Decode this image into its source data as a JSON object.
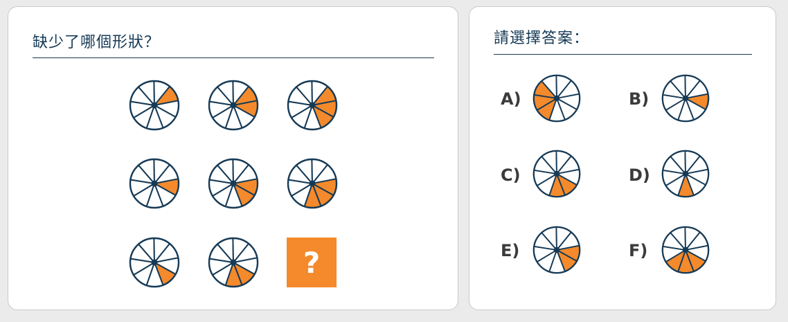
{
  "puzzle": {
    "title": "缺少了哪個形狀？",
    "missing_symbol": "?",
    "grid": [
      [
        {
          "shaded": [
            0
          ]
        },
        {
          "shaded": [
            0,
            1
          ]
        },
        {
          "shaded": [
            0,
            1,
            2
          ]
        }
      ],
      [
        {
          "shaded": [
            1
          ]
        },
        {
          "shaded": [
            1,
            2
          ]
        },
        {
          "shaded": [
            1,
            2,
            3
          ]
        }
      ],
      [
        {
          "shaded": [
            2
          ]
        },
        {
          "shaded": [
            2,
            3
          ]
        },
        null
      ]
    ]
  },
  "answers": {
    "title": "請選擇答案：",
    "options": [
      {
        "label": "A)",
        "shaded": [
          4,
          5,
          6
        ]
      },
      {
        "label": "B)",
        "shaded": [
          1
        ]
      },
      {
        "label": "C)",
        "shaded": [
          2,
          3
        ]
      },
      {
        "label": "D)",
        "shaded": [
          3
        ]
      },
      {
        "label": "E)",
        "shaded": [
          1,
          2
        ]
      },
      {
        "label": "F)",
        "shaded": [
          2,
          3,
          4
        ]
      }
    ]
  },
  "wheel": {
    "segments": 9,
    "fill_color": "#f48a2b",
    "stroke_color": "#163a56"
  }
}
